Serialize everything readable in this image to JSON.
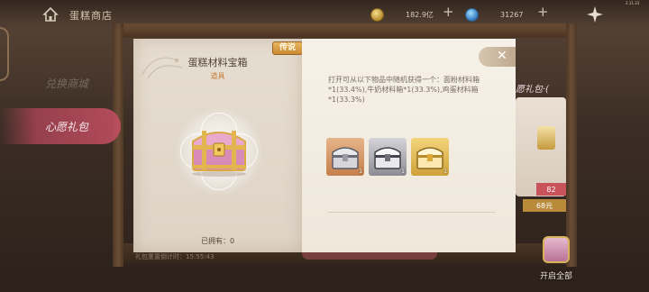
{
  "topbar": {
    "title": "蛋糕商店",
    "gold_amount": "182.9亿",
    "gem_amount": "31267",
    "plus": "+",
    "version": "2.11.33"
  },
  "tabs": [
    {
      "label": "兑换商城",
      "active": false
    },
    {
      "label": "心愿礼包",
      "active": true
    }
  ],
  "background": {
    "card_title": "愿礼包·(",
    "price_red": "82",
    "price_gold": "68元",
    "open_all": "开启全部",
    "timer": "礼包重置倒计时：15:55:43"
  },
  "modal": {
    "rarity_badge": "传说",
    "item_name": "蛋糕材料宝箱",
    "item_type": "道具",
    "owned_text": "已拥有：0",
    "description": "打开可从以下物品中随机获得一个：面粉材料箱*1(33.4%),牛奶材料箱*1(33.3%),鸡蛋材料箱*1(33.3%)",
    "rewards": [
      {
        "icon": "copper-chest-icon",
        "qty": "1",
        "color": "#c57f4b"
      },
      {
        "icon": "silver-chest-icon",
        "qty": "1",
        "color": "#8c8c94"
      },
      {
        "icon": "gold-chest-icon",
        "qty": "1",
        "color": "#cfa23a"
      }
    ],
    "close_icon": "close-icon"
  },
  "colors": {
    "accent_pink": "#c9535a",
    "badge_gold": "#e9b65e",
    "type_orange": "#c57c3c"
  }
}
